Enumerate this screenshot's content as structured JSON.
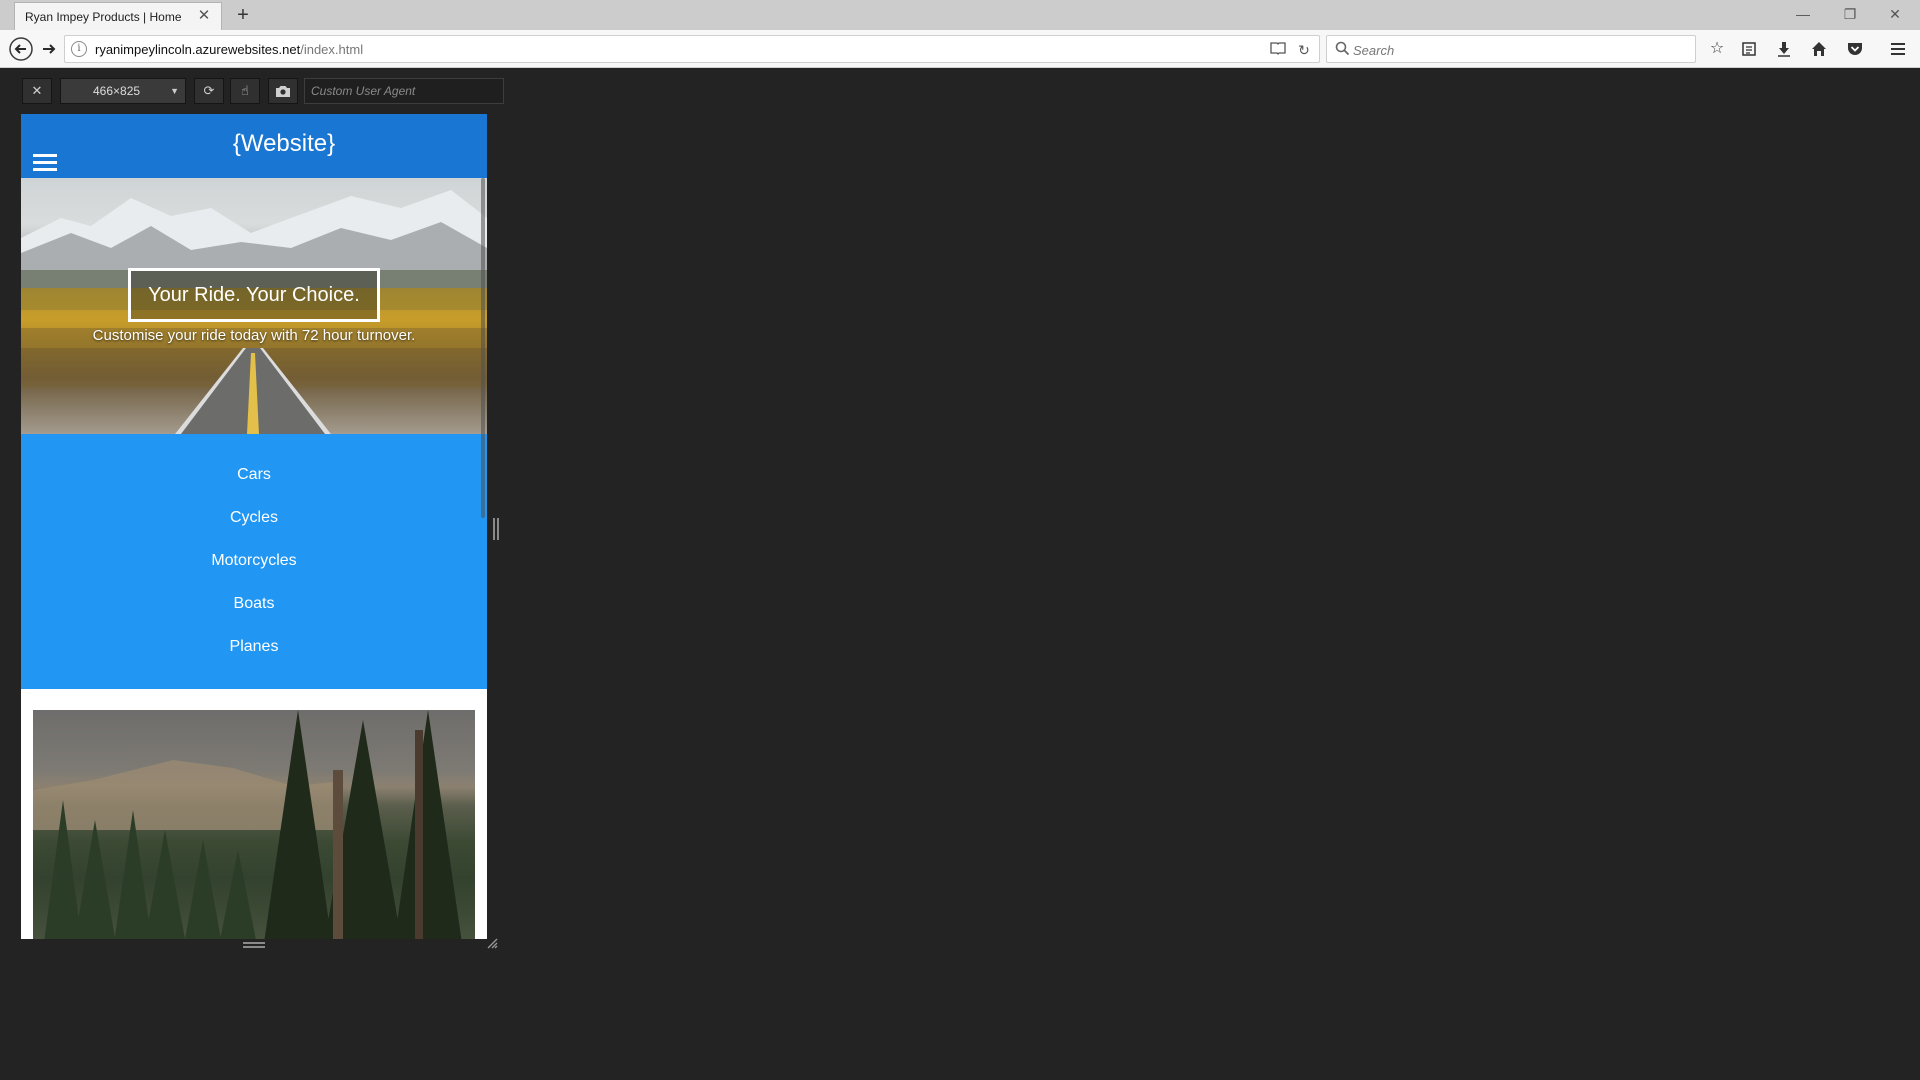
{
  "browser": {
    "tab_title": "Ryan Impey Products | Home",
    "tab_close": "✕",
    "new_tab": "+",
    "window_controls": {
      "minimize": "—",
      "restore": "❐",
      "close": "✕"
    },
    "url_domain": "ryanimpeylincoln.azurewebsites.net",
    "url_path": "/index.html",
    "search_placeholder": "Search",
    "nav": {
      "back": "◀",
      "forward": "▶",
      "reload": "↻"
    },
    "toolbar_icons": [
      "star-icon",
      "reading-list-icon",
      "download-icon",
      "home-icon",
      "pocket-icon",
      "menu-icon"
    ]
  },
  "rdm": {
    "close": "✕",
    "size": "466×825",
    "rotate": "⟳",
    "touch": "☝",
    "screenshot": "⌷",
    "user_agent_placeholder": "Custom User Agent"
  },
  "site": {
    "title": "{Website}",
    "hero_heading": "Your Ride. Your Choice.",
    "hero_subheading": "Customise your ride today with 72 hour turnover.",
    "menu": [
      "Cars",
      "Cycles",
      "Motorcycles",
      "Boats",
      "Planes"
    ],
    "colors": {
      "header": "#1976d2",
      "menu": "#2196f3",
      "chrome_bg": "#232323"
    }
  }
}
